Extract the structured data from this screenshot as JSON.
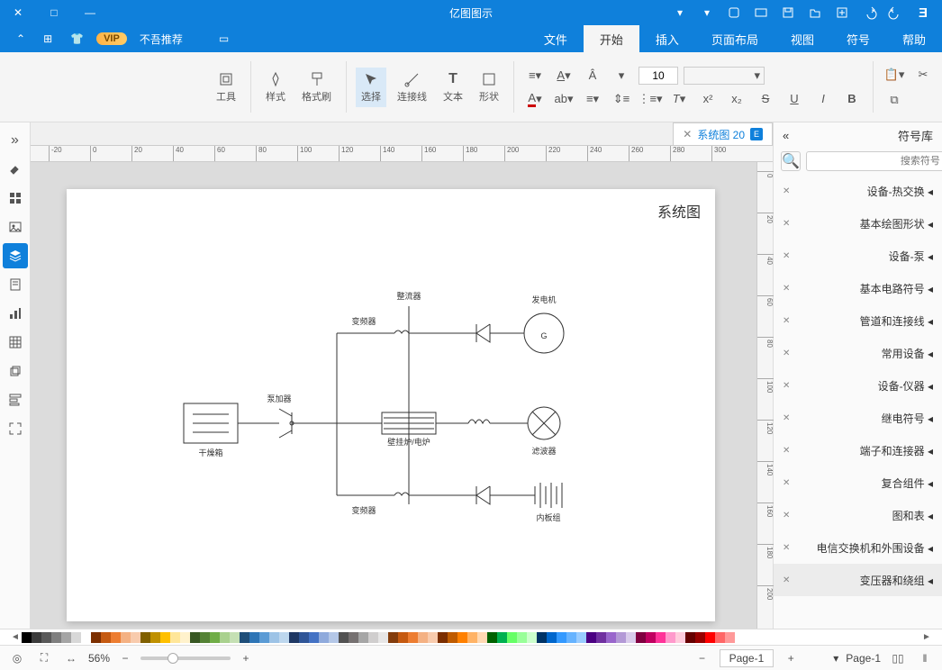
{
  "window": {
    "title": "亿图图示"
  },
  "menubar": {
    "left": [
      "不吾推荐"
    ],
    "vip": "VIP",
    "tabs": [
      "文件",
      "开始",
      "插入",
      "页面布局",
      "视图",
      "符号",
      "帮助"
    ],
    "active_tab": "开始"
  },
  "ribbon": {
    "font_size": "10",
    "select_label": "选择",
    "connector_label": "连接线",
    "text_label": "文本",
    "shape_label": "形状",
    "brush_label": "格式刷",
    "style_label": "样式",
    "tools_label": "工具"
  },
  "doc_tab": {
    "label": "系统图 20"
  },
  "right_panel": {
    "header": "符号库",
    "header_toggle": "«",
    "search_placeholder": "搜索符号",
    "categories": [
      "设备-热交换",
      "基本绘图形状",
      "设备-泵",
      "基本电路符号",
      "管道和连接线",
      "常用设备",
      "设备-仪器",
      "继电符号",
      "端子和连接器",
      "复合组件",
      "图和表",
      "电信交换机和外围设备",
      "变压器和绕组"
    ],
    "active_index": 12
  },
  "left_toolbar": {
    "items": [
      "collapse",
      "paint",
      "grid",
      "image",
      "layers",
      "page",
      "chart",
      "table",
      "shape3d",
      "task",
      "fullscreen"
    ],
    "active_index": 4
  },
  "canvas": {
    "page_title": "系统图",
    "labels": {
      "generator": "发电机",
      "transformer1": "变频器",
      "transformer2": "变频器",
      "rectifier": "整流器",
      "pump": "泵加器",
      "heater": "壁挂炉/电炉",
      "dryer": "干燥箱",
      "filter": "滤波器",
      "battery": "内板组"
    }
  },
  "colorbar_colors": [
    "#000000",
    "#3b3b3b",
    "#595959",
    "#7f7f7f",
    "#a5a5a5",
    "#d8d8d8",
    "#ffffff",
    "#7c2f00",
    "#c55a11",
    "#ed7d31",
    "#f4b183",
    "#f8cbad",
    "#806000",
    "#bf9000",
    "#ffc000",
    "#ffe699",
    "#fff2cc",
    "#385723",
    "#548235",
    "#70ad47",
    "#a9d18e",
    "#c5e0b4",
    "#1f4e79",
    "#2e75b6",
    "#5b9bd5",
    "#9dc3e6",
    "#bdd7ee",
    "#1f3864",
    "#2f5597",
    "#4472c4",
    "#8faadc",
    "#b4c7e7",
    "#525252",
    "#767171",
    "#a6a6a6",
    "#d0cece",
    "#e7e6e6",
    "#833c0c",
    "#c55a11",
    "#ed7d31",
    "#f4b183",
    "#f8cbad",
    "#7b2e00",
    "#bf5b00",
    "#ff8000",
    "#ffb366",
    "#ffd9b3",
    "#006100",
    "#00b050",
    "#66ff66",
    "#99ff99",
    "#ccffcc",
    "#003366",
    "#0066cc",
    "#3399ff",
    "#66b3ff",
    "#99ccff",
    "#4b0082",
    "#7030a0",
    "#9966cc",
    "#b399d6",
    "#d9cceb",
    "#800040",
    "#c00060",
    "#ff3399",
    "#ff99cc",
    "#ffccdd",
    "#660000",
    "#990000",
    "#ff0000",
    "#ff6666",
    "#ff9999"
  ],
  "statusbar": {
    "page_left": "Page-1",
    "page_right": "Page-1",
    "zoom": "56%"
  },
  "ruler_h": [
    "-20",
    "0",
    "20",
    "40",
    "60",
    "80",
    "100",
    "120",
    "140",
    "160",
    "180",
    "200",
    "220",
    "240",
    "260",
    "280",
    "300"
  ],
  "ruler_v": [
    "0",
    "20",
    "40",
    "60",
    "80",
    "100",
    "120",
    "140",
    "160",
    "180",
    "200"
  ]
}
